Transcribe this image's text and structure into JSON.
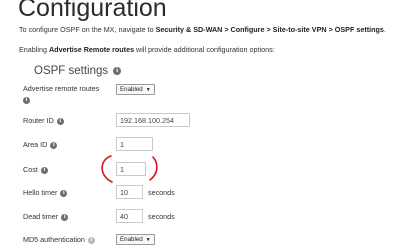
{
  "page": {
    "title": "Configuration"
  },
  "intro": {
    "line1_prefix": "To configure OSPF on the MX, navigate to ",
    "line1_path": "Security & SD-WAN > Configure > Site-to-site VPN > OSPF settings",
    "line1_suffix": ".",
    "line2_prefix": "Enabling ",
    "line2_bold": "Advertise Remote routes",
    "line2_suffix": " will provide additional configuration options:"
  },
  "section": {
    "title": "OSPF settings"
  },
  "fields": {
    "advertise_remote_routes": {
      "label": "Advertise remote routes",
      "value": "Enabled"
    },
    "router_id": {
      "label": "Router ID",
      "value": "192.168.100.254"
    },
    "area_id": {
      "label": "Area ID",
      "value": "1"
    },
    "cost": {
      "label": "Cost",
      "value": "1"
    },
    "hello_timer": {
      "label": "Hello timer",
      "value": "10",
      "unit": "seconds"
    },
    "dead_timer": {
      "label": "Dead timer",
      "value": "40",
      "unit": "seconds"
    },
    "md5_authentication": {
      "label": "MD5 authentication",
      "value": "Enabled"
    }
  },
  "icons": {
    "info": "info-icon",
    "dropdown": "chevron-down-icon"
  },
  "colors": {
    "annotation": "#d4151b"
  }
}
